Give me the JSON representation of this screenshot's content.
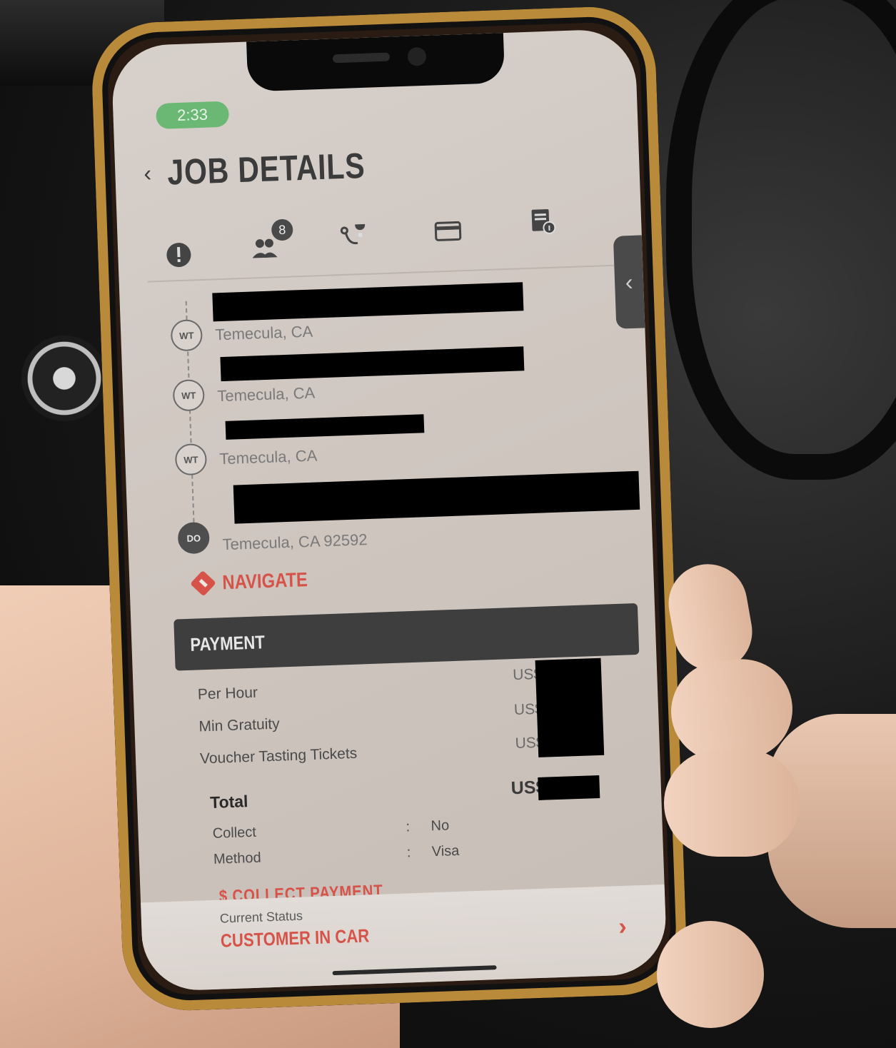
{
  "status_bar": {
    "time": "2:33"
  },
  "header": {
    "back_icon": "chevron-left-icon",
    "title": "JOB DETAILS"
  },
  "tabs": [
    {
      "icon": "alert-icon"
    },
    {
      "icon": "passengers-icon",
      "badge": "8"
    },
    {
      "icon": "route-icon"
    },
    {
      "icon": "payment-card-icon"
    },
    {
      "icon": "document-info-icon"
    }
  ],
  "stops": [
    {
      "marker": "WT",
      "city": "Temecula, CA",
      "address_redacted": true
    },
    {
      "marker": "WT",
      "city": "Temecula, CA",
      "address_redacted": true
    },
    {
      "marker": "WT",
      "city": "Temecula, CA",
      "address_redacted": true
    },
    {
      "marker": "DO",
      "city": "Temecula, CA 92592",
      "address_redacted": true
    }
  ],
  "navigate": {
    "label": "NAVIGATE"
  },
  "payment": {
    "title": "PAYMENT",
    "rows": [
      {
        "label": "Per Hour",
        "currency": "US$"
      },
      {
        "label": "Min Gratuity",
        "currency": "US$"
      },
      {
        "label": "Voucher Tasting Tickets",
        "currency": "US$"
      }
    ],
    "total": {
      "label": "Total",
      "currency": "US$"
    },
    "details": [
      {
        "key": "Collect",
        "separator": ":",
        "value": "No"
      },
      {
        "key": "Method",
        "separator": ":",
        "value": "Visa"
      }
    ],
    "collect_label": "$ COLLECT PAYMENT"
  },
  "current_status": {
    "caption": "Current Status",
    "value": "CUSTOMER IN CAR",
    "arrow": "›"
  },
  "colors": {
    "accent": "#d6534a",
    "header_bar": "#3e3e3e",
    "time_pill": "#6bb874"
  }
}
